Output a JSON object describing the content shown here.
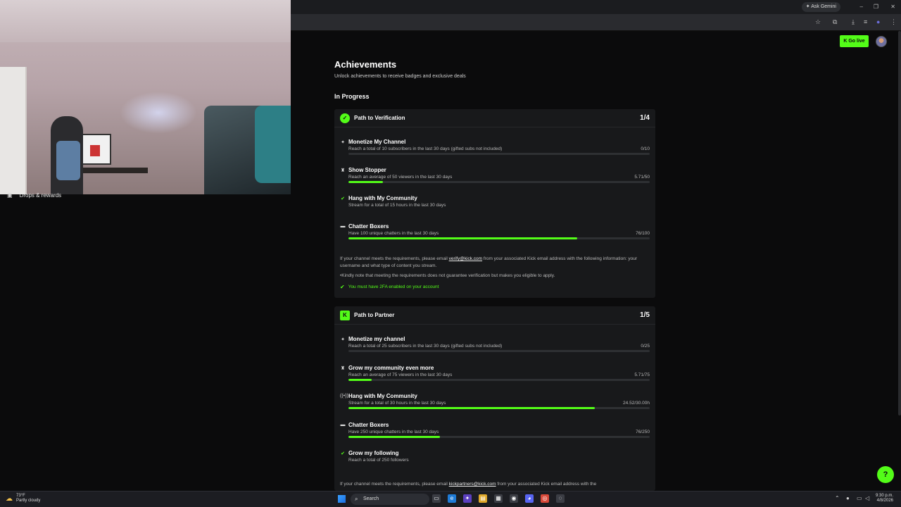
{
  "browser": {
    "gemini_label": "Ask Gemini",
    "minimize": "–",
    "restore": "❐",
    "close": "✕"
  },
  "sidebar": {
    "rewards_label": "Drops & rewards"
  },
  "header": {
    "golive_label": "Go live"
  },
  "page": {
    "title": "Achievements",
    "subtitle": "Unlock achievements to receive badges and exclusive deals",
    "section_label": "In Progress"
  },
  "verification": {
    "title": "Path to Verification",
    "count": "1/4",
    "tasks": [
      {
        "name": "Monetize My Channel",
        "desc": "Reach a total of 10 subscribers in the last 30 days (gifted subs not included)",
        "value": "0/10",
        "progress": 0,
        "done": false,
        "icon": "✦"
      },
      {
        "name": "Show Stopper",
        "desc": "Reach an average of 50 viewers in the last 30 days",
        "value": "5.71/50",
        "progress": 0.114,
        "done": false,
        "icon": "♜"
      },
      {
        "name": "Hang with My Community",
        "desc": "Stream for a total of 15 hours in the last 30 days",
        "value": "",
        "progress": null,
        "done": true,
        "icon": "✓"
      },
      {
        "name": "Chatter Boxers",
        "desc": "Have 100 unique chatters in the last 30 days",
        "value": "76/100",
        "progress": 0.76,
        "done": false,
        "icon": "▬"
      }
    ],
    "note_prefix": "If your channel meets the requirements, please email ",
    "note_email": "verify@kick.com",
    "note_suffix": " from your associated Kick email address with the following information: your username and what type of content you stream.",
    "disclaimer": "•Kindly note that meeting the requirements does not guarantee verification but makes you eligible to apply.",
    "requirement": "You must have 2FA enabled on your account"
  },
  "partner": {
    "title": "Path to Partner",
    "count": "1/5",
    "tasks": [
      {
        "name": "Monetize my channel",
        "desc": "Reach a total of 25 subscribers in the last 30 days (gifted subs not included)",
        "value": "0/25",
        "progress": 0,
        "done": false,
        "icon": "✦"
      },
      {
        "name": "Grow my community even more",
        "desc": "Reach an average of 75 viewers in the last 30 days",
        "value": "5.71/75",
        "progress": 0.076,
        "done": false,
        "icon": "♜"
      },
      {
        "name": "Hang with My Community",
        "desc": "Stream for a total of 30 hours in the last 30 days",
        "value": "24.52/30.00h",
        "progress": 0.817,
        "done": false,
        "icon": "((•))"
      },
      {
        "name": "Chatter Boxers",
        "desc": "Have 250 unique chatters in the last 30 days",
        "value": "76/250",
        "progress": 0.304,
        "done": false,
        "icon": "▬"
      },
      {
        "name": "Grow my following",
        "desc": "Reach a total of 250 followers",
        "value": "",
        "progress": null,
        "done": true,
        "icon": "✓"
      }
    ],
    "note_prefix": "If your channel meets the requirements, please email ",
    "note_email": "kickpartners@kick.com",
    "note_suffix": " from your associated Kick email address with the"
  },
  "taskbar": {
    "temp": "73°F",
    "weather": "Partly cloudy",
    "search_label": "Search",
    "time": "9:30 p.m.",
    "date": "4/8/2026"
  },
  "colors": {
    "accent": "#53fc18",
    "background": "#0b0b0c",
    "card": "#18191b"
  }
}
